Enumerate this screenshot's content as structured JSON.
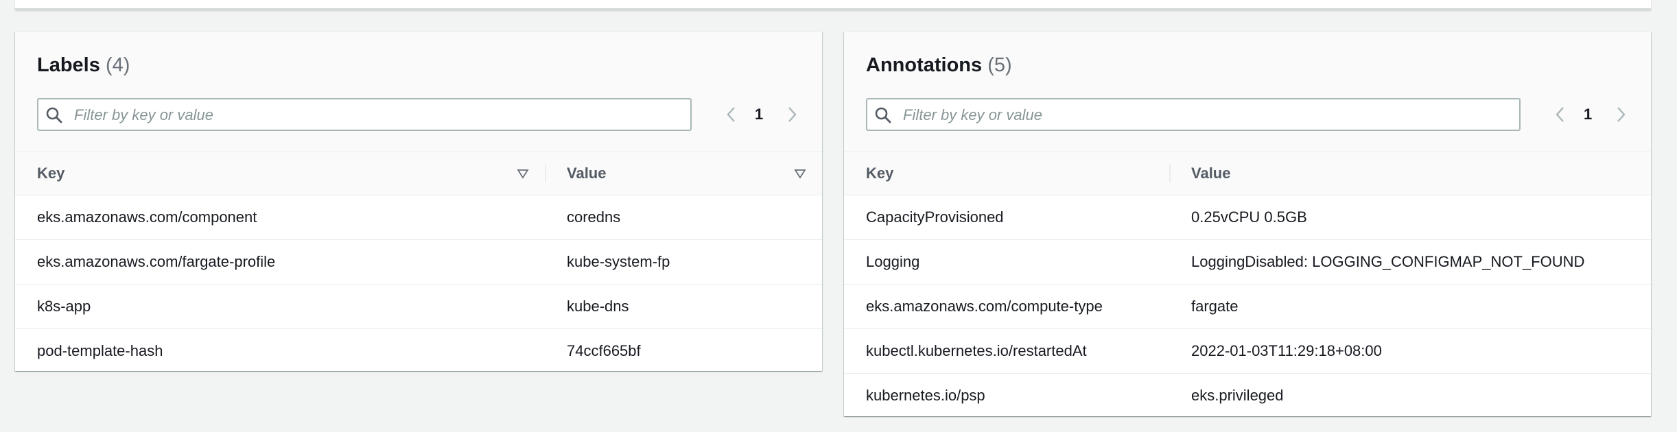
{
  "labels": {
    "title": "Labels",
    "count": "(4)",
    "filter_placeholder": "Filter by key or value",
    "page": "1",
    "columns": [
      "Key",
      "Value"
    ],
    "rows": [
      {
        "key": "eks.amazonaws.com/component",
        "value": "coredns"
      },
      {
        "key": "eks.amazonaws.com/fargate-profile",
        "value": "kube-system-fp"
      },
      {
        "key": "k8s-app",
        "value": "kube-dns"
      },
      {
        "key": "pod-template-hash",
        "value": "74ccf665bf"
      }
    ]
  },
  "annotations": {
    "title": "Annotations",
    "count": "(5)",
    "filter_placeholder": "Filter by key or value",
    "page": "1",
    "columns": [
      "Key",
      "Value"
    ],
    "rows": [
      {
        "key": "CapacityProvisioned",
        "value": "0.25vCPU 0.5GB"
      },
      {
        "key": "Logging",
        "value": "LoggingDisabled: LOGGING_CONFIGMAP_NOT_FOUND"
      },
      {
        "key": "eks.amazonaws.com/compute-type",
        "value": "fargate"
      },
      {
        "key": "kubectl.kubernetes.io/restartedAt",
        "value": "2022-01-03T11:29:18+08:00"
      },
      {
        "key": "kubernetes.io/psp",
        "value": "eks.privileged"
      }
    ]
  }
}
